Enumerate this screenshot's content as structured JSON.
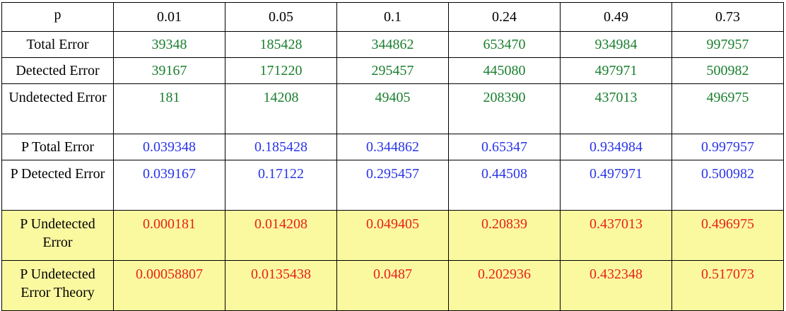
{
  "table": {
    "header": {
      "label": "p",
      "values": [
        "0.01",
        "0.05",
        "0.1",
        "0.24",
        "0.49",
        "0.73"
      ]
    },
    "rows": [
      {
        "label": "Total Error",
        "values": [
          "39348",
          "185428",
          "344862",
          "653470",
          "934984",
          "997957"
        ]
      },
      {
        "label": "Detected Error",
        "values": [
          "39167",
          "171220",
          "295457",
          "445080",
          "497971",
          "500982"
        ]
      },
      {
        "label": "Undetected Error",
        "values": [
          "181",
          "14208",
          "49405",
          "208390",
          "437013",
          "496975"
        ]
      },
      {
        "label": "P Total Error",
        "values": [
          "0.039348",
          "0.185428",
          "0.344862",
          "0.65347",
          "0.934984",
          "0.997957"
        ]
      },
      {
        "label": "P Detected Error",
        "values": [
          "0.039167",
          "0.17122",
          "0.295457",
          "0.44508",
          "0.497971",
          "0.500982"
        ]
      },
      {
        "label": "P Undetected Error",
        "values": [
          "0.000181",
          "0.014208",
          "0.049405",
          "0.20839",
          "0.437013",
          "0.496975"
        ]
      },
      {
        "label": "P Undetected Error Theory",
        "values": [
          "0.00058807",
          "0.0135438",
          "0.0487",
          "0.202936",
          "0.432348",
          "0.517073"
        ]
      }
    ]
  },
  "colors": {
    "count_text": "#1a7f2e",
    "probability_text": "#2a35e8",
    "undetected_probability_text": "#e8201a",
    "highlight_background": "#fbf9a0"
  }
}
